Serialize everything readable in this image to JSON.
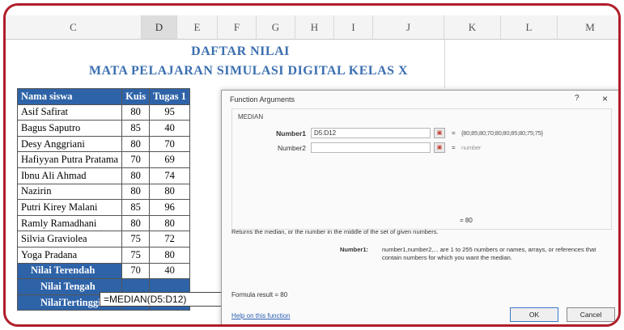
{
  "columns": [
    "C",
    "D",
    "E",
    "F",
    "G",
    "H",
    "I",
    "J",
    "K",
    "L",
    "M"
  ],
  "title_line1": "DAFTAR NILAI",
  "title_line2": "MATA PELAJARAN SIMULASI DIGITAL KELAS X",
  "table": {
    "headers": [
      "Nama siswa",
      "Kuis",
      "Tugas 1"
    ],
    "rows": [
      {
        "name": "Asif Safirat",
        "kuis": "80",
        "tugas": "95"
      },
      {
        "name": "Bagus Saputro",
        "kuis": "85",
        "tugas": "40"
      },
      {
        "name": "Desy Anggriani",
        "kuis": "80",
        "tugas": "70"
      },
      {
        "name": "Hafiyyan Putra Pratama",
        "kuis": "70",
        "tugas": "69"
      },
      {
        "name": "Ibnu Ali Ahmad",
        "kuis": "80",
        "tugas": "74"
      },
      {
        "name": "Nazirin",
        "kuis": "80",
        "tugas": "80"
      },
      {
        "name": "Putri Kirey Malani",
        "kuis": "85",
        "tugas": "96"
      },
      {
        "name": "Ramly Ramadhani",
        "kuis": "80",
        "tugas": "80"
      },
      {
        "name": "Silvia Graviolea",
        "kuis": "75",
        "tugas": "72"
      },
      {
        "name": "Yoga Pradana",
        "kuis": "75",
        "tugas": "80"
      }
    ],
    "summary": [
      {
        "label": "Nilai Terendah",
        "kuis": "70",
        "tugas": "40"
      },
      {
        "label": "Nilai Tengah",
        "kuis": "",
        "tugas": ""
      },
      {
        "label": "NilaiTertinggi",
        "kuis": "",
        "tugas": ""
      }
    ],
    "formula_cell": "=MEDIAN(D5:D12)"
  },
  "dialog": {
    "title": "Function Arguments",
    "help": "?",
    "close": "×",
    "function_name": "MEDIAN",
    "arg1_label": "Number1",
    "arg1_value": "D5:D12",
    "arg1_result": "{80;85;80;70;80;80;85;80;75;75}",
    "arg2_label": "Number2",
    "arg2_value": "",
    "arg2_result": "number",
    "result_value": "= 80",
    "description": "Returns the median, or the number in the middle of the set of given numbers.",
    "number1_label": "Number1:",
    "number1_desc": "number1,number2,... are 1 to 255 numbers or names, arrays, or references that contain numbers for which you want the median.",
    "formula_result": "Formula result =  80",
    "help_link": "Help on this function",
    "ok": "OK",
    "cancel": "Cancel"
  }
}
